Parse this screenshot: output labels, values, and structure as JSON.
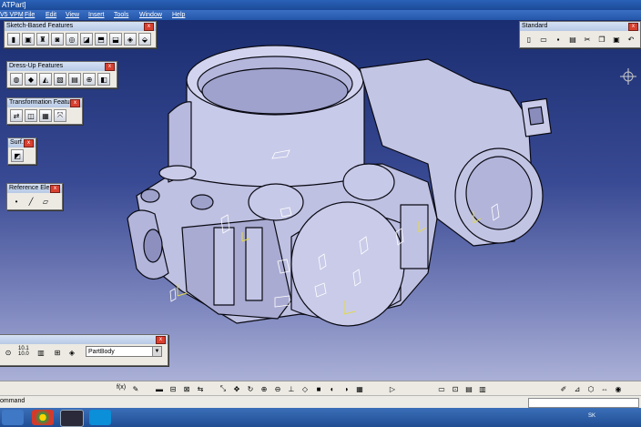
{
  "window": {
    "title": "ATPart]"
  },
  "menu": [
    "V5 VPM",
    "File",
    "Edit",
    "View",
    "Insert",
    "Tools",
    "Window",
    "Help"
  ],
  "toolbars": {
    "sketch_based": {
      "title": "Sketch-Based Features",
      "close": "x"
    },
    "dress_up": {
      "title": "Dress-Up Features",
      "close": "x"
    },
    "transformation": {
      "title": "Transformation Features",
      "close": "x"
    },
    "surface": {
      "title": "Surf...",
      "close": "x"
    },
    "reference": {
      "title": "Reference Ele...",
      "close": "x"
    },
    "standard": {
      "title": "Standard",
      "close": "x"
    },
    "body_select": {
      "close": "x",
      "selected": "PartBody",
      "readout_top": "10.1",
      "readout_bottom": "10.0"
    }
  },
  "bottom_toolbar": {
    "fx_label": "f(x)"
  },
  "command": {
    "label": "ommand"
  },
  "taskbar": {
    "tray_lang": "SK"
  },
  "colors": {
    "viewport_top": "#1a2d70",
    "viewport_bottom": "#aab0d6",
    "part": "#c4c6e6",
    "edge": "#0a0a14"
  }
}
